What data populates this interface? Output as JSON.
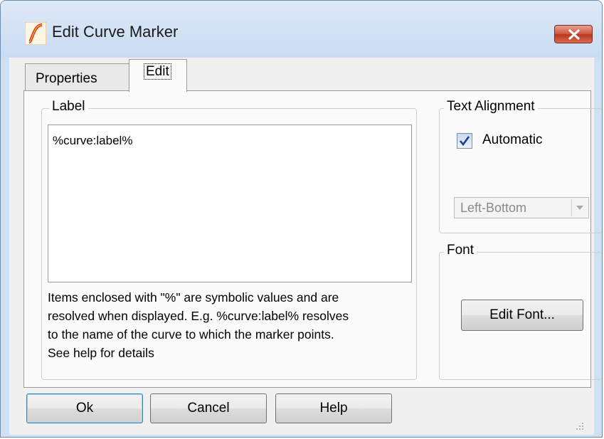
{
  "window": {
    "title": "Edit Curve Marker",
    "accent": "#1a4fb0",
    "close_color": "#c8452b"
  },
  "tabs": [
    {
      "label": "Properties",
      "active": false
    },
    {
      "label": "Edit",
      "active": true
    }
  ],
  "label_group": {
    "title": "Label",
    "text_value": "%curve:label%",
    "help_lines": [
      "Items enclosed with \"%\" are symbolic values and are",
      "resolved when displayed. E.g. %curve:label% resolves",
      "to the name of the curve to which the marker points.",
      "See help for details"
    ]
  },
  "text_alignment": {
    "title": "Text Alignment",
    "automatic_label": "Automatic",
    "automatic_checked": true,
    "select_value": "Left-Bottom",
    "select_enabled": false
  },
  "font_group": {
    "title": "Font",
    "edit_font_label": "Edit Font..."
  },
  "buttons": {
    "ok": "Ok",
    "cancel": "Cancel",
    "help": "Help"
  }
}
